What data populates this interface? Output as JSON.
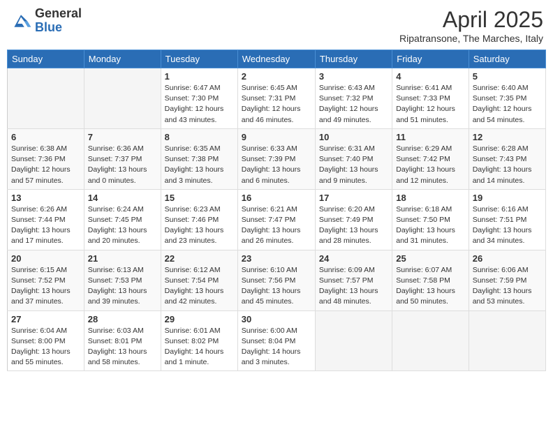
{
  "header": {
    "logo_general": "General",
    "logo_blue": "Blue",
    "month": "April 2025",
    "location": "Ripatransone, The Marches, Italy"
  },
  "days_of_week": [
    "Sunday",
    "Monday",
    "Tuesday",
    "Wednesday",
    "Thursday",
    "Friday",
    "Saturday"
  ],
  "weeks": [
    [
      {
        "day": "",
        "info": ""
      },
      {
        "day": "",
        "info": ""
      },
      {
        "day": "1",
        "info": "Sunrise: 6:47 AM\nSunset: 7:30 PM\nDaylight: 12 hours and 43 minutes."
      },
      {
        "day": "2",
        "info": "Sunrise: 6:45 AM\nSunset: 7:31 PM\nDaylight: 12 hours and 46 minutes."
      },
      {
        "day": "3",
        "info": "Sunrise: 6:43 AM\nSunset: 7:32 PM\nDaylight: 12 hours and 49 minutes."
      },
      {
        "day": "4",
        "info": "Sunrise: 6:41 AM\nSunset: 7:33 PM\nDaylight: 12 hours and 51 minutes."
      },
      {
        "day": "5",
        "info": "Sunrise: 6:40 AM\nSunset: 7:35 PM\nDaylight: 12 hours and 54 minutes."
      }
    ],
    [
      {
        "day": "6",
        "info": "Sunrise: 6:38 AM\nSunset: 7:36 PM\nDaylight: 12 hours and 57 minutes."
      },
      {
        "day": "7",
        "info": "Sunrise: 6:36 AM\nSunset: 7:37 PM\nDaylight: 13 hours and 0 minutes."
      },
      {
        "day": "8",
        "info": "Sunrise: 6:35 AM\nSunset: 7:38 PM\nDaylight: 13 hours and 3 minutes."
      },
      {
        "day": "9",
        "info": "Sunrise: 6:33 AM\nSunset: 7:39 PM\nDaylight: 13 hours and 6 minutes."
      },
      {
        "day": "10",
        "info": "Sunrise: 6:31 AM\nSunset: 7:40 PM\nDaylight: 13 hours and 9 minutes."
      },
      {
        "day": "11",
        "info": "Sunrise: 6:29 AM\nSunset: 7:42 PM\nDaylight: 13 hours and 12 minutes."
      },
      {
        "day": "12",
        "info": "Sunrise: 6:28 AM\nSunset: 7:43 PM\nDaylight: 13 hours and 14 minutes."
      }
    ],
    [
      {
        "day": "13",
        "info": "Sunrise: 6:26 AM\nSunset: 7:44 PM\nDaylight: 13 hours and 17 minutes."
      },
      {
        "day": "14",
        "info": "Sunrise: 6:24 AM\nSunset: 7:45 PM\nDaylight: 13 hours and 20 minutes."
      },
      {
        "day": "15",
        "info": "Sunrise: 6:23 AM\nSunset: 7:46 PM\nDaylight: 13 hours and 23 minutes."
      },
      {
        "day": "16",
        "info": "Sunrise: 6:21 AM\nSunset: 7:47 PM\nDaylight: 13 hours and 26 minutes."
      },
      {
        "day": "17",
        "info": "Sunrise: 6:20 AM\nSunset: 7:49 PM\nDaylight: 13 hours and 28 minutes."
      },
      {
        "day": "18",
        "info": "Sunrise: 6:18 AM\nSunset: 7:50 PM\nDaylight: 13 hours and 31 minutes."
      },
      {
        "day": "19",
        "info": "Sunrise: 6:16 AM\nSunset: 7:51 PM\nDaylight: 13 hours and 34 minutes."
      }
    ],
    [
      {
        "day": "20",
        "info": "Sunrise: 6:15 AM\nSunset: 7:52 PM\nDaylight: 13 hours and 37 minutes."
      },
      {
        "day": "21",
        "info": "Sunrise: 6:13 AM\nSunset: 7:53 PM\nDaylight: 13 hours and 39 minutes."
      },
      {
        "day": "22",
        "info": "Sunrise: 6:12 AM\nSunset: 7:54 PM\nDaylight: 13 hours and 42 minutes."
      },
      {
        "day": "23",
        "info": "Sunrise: 6:10 AM\nSunset: 7:56 PM\nDaylight: 13 hours and 45 minutes."
      },
      {
        "day": "24",
        "info": "Sunrise: 6:09 AM\nSunset: 7:57 PM\nDaylight: 13 hours and 48 minutes."
      },
      {
        "day": "25",
        "info": "Sunrise: 6:07 AM\nSunset: 7:58 PM\nDaylight: 13 hours and 50 minutes."
      },
      {
        "day": "26",
        "info": "Sunrise: 6:06 AM\nSunset: 7:59 PM\nDaylight: 13 hours and 53 minutes."
      }
    ],
    [
      {
        "day": "27",
        "info": "Sunrise: 6:04 AM\nSunset: 8:00 PM\nDaylight: 13 hours and 55 minutes."
      },
      {
        "day": "28",
        "info": "Sunrise: 6:03 AM\nSunset: 8:01 PM\nDaylight: 13 hours and 58 minutes."
      },
      {
        "day": "29",
        "info": "Sunrise: 6:01 AM\nSunset: 8:02 PM\nDaylight: 14 hours and 1 minute."
      },
      {
        "day": "30",
        "info": "Sunrise: 6:00 AM\nSunset: 8:04 PM\nDaylight: 14 hours and 3 minutes."
      },
      {
        "day": "",
        "info": ""
      },
      {
        "day": "",
        "info": ""
      },
      {
        "day": "",
        "info": ""
      }
    ]
  ]
}
